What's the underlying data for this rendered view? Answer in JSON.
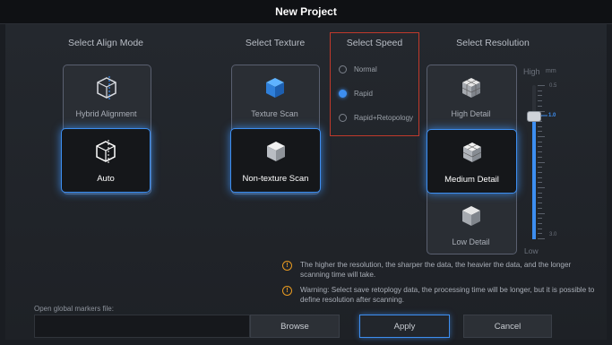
{
  "title": "New Project",
  "align_mode": {
    "heading": "Select Align Mode",
    "options": [
      {
        "label": "Hybrid Alignment",
        "selected": false
      },
      {
        "label": "Auto",
        "selected": true
      }
    ]
  },
  "texture": {
    "heading": "Select Texture",
    "options": [
      {
        "label": "Texture Scan",
        "selected": false
      },
      {
        "label": "Non-texture Scan",
        "selected": true
      }
    ]
  },
  "speed": {
    "heading": "Select Speed",
    "options": [
      {
        "label": "Normal",
        "selected": false
      },
      {
        "label": "Rapid",
        "selected": true
      },
      {
        "label": "Rapid+Retopology",
        "selected": false
      }
    ]
  },
  "resolution": {
    "heading": "Select Resolution",
    "options": [
      {
        "label": "High Detail",
        "selected": false
      },
      {
        "label": "Medium Detail",
        "selected": true
      },
      {
        "label": "Low Detail",
        "selected": false
      }
    ],
    "slider": {
      "high_label": "High",
      "unit": "mm",
      "max": "0.5",
      "value": "1.0",
      "min": "3.0",
      "low_label": "Low",
      "level": 0.83
    }
  },
  "notes": [
    "The higher the resolution, the sharper the data, the heavier the data, and the longer scanning time will take.",
    "Warning: Select save retoplogy data, the processing time will be longer, but it is possible to define resolution after scanning."
  ],
  "markers": {
    "label": "Open global markers file:",
    "value": ""
  },
  "buttons": {
    "browse": "Browse",
    "apply": "Apply",
    "cancel": "Cancel"
  },
  "colors": {
    "accent": "#3d8ef0",
    "warning": "#e89a21",
    "speed_outline": "#c0392b"
  }
}
